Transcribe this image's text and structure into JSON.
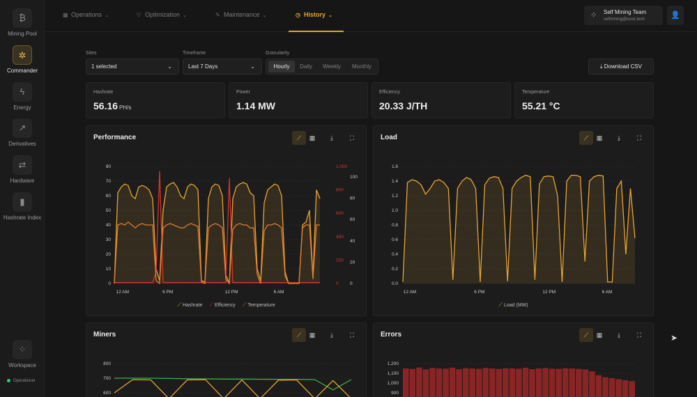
{
  "sidebar": {
    "items": [
      {
        "label": "Mining Pool",
        "icon": "bitcoin-icon",
        "glyph": "₿"
      },
      {
        "label": "Commander",
        "icon": "miner-fan-icon",
        "glyph": "✲"
      },
      {
        "label": "Energy",
        "icon": "lightning-icon",
        "glyph": "ϟ"
      },
      {
        "label": "Derivatives",
        "icon": "chart-icon",
        "glyph": "↗"
      },
      {
        "label": "Hardware",
        "icon": "swap-arrows-icon",
        "glyph": "⇄"
      },
      {
        "label": "Hashrate Index",
        "icon": "bar-chart-icon",
        "glyph": "▮"
      },
      {
        "label": "Workspace",
        "icon": "workspace-dots-icon",
        "glyph": "⁘"
      }
    ],
    "status": "Operational",
    "status_color": "#2ecc71"
  },
  "nav": {
    "tabs": [
      {
        "label": "Operations",
        "icon": "grid-icon",
        "glyph": "▦"
      },
      {
        "label": "Optimization",
        "icon": "filter-icon",
        "glyph": "▽"
      },
      {
        "label": "Maintenance",
        "icon": "wrench-icon",
        "glyph": "✎"
      },
      {
        "label": "History",
        "icon": "clock-icon",
        "glyph": "◷"
      }
    ],
    "team_name": "Self Mining Team",
    "team_email": "selfmining@luxor.tech"
  },
  "filters": {
    "sites_label": "Sites",
    "sites_value": "1 selected",
    "timeframe_label": "Timeframe",
    "timeframe_value": "Last 7 Days",
    "granularity_label": "Granularity",
    "granularity_options": [
      "Hourly",
      "Daily",
      "Weekly",
      "Monthly"
    ],
    "download_label": "Download CSV"
  },
  "stats": [
    {
      "label": "Hashrate",
      "value": "56.16",
      "unit": "PH/s"
    },
    {
      "label": "Power",
      "value": "1.14 MW",
      "unit": ""
    },
    {
      "label": "Efficiency",
      "value": "20.33 J/TH",
      "unit": ""
    },
    {
      "label": "Temperature",
      "value": "55.21 °C",
      "unit": ""
    }
  ],
  "colors": {
    "accent": "#e8a532",
    "efficiency": "#d9342b",
    "temperature": "#e07b2e",
    "miners_green": "#3fae4a",
    "errors_red": "#8a2525"
  },
  "panels": {
    "performance": {
      "title": "Performance"
    },
    "load": {
      "title": "Load"
    },
    "miners": {
      "title": "Miners"
    },
    "errors": {
      "title": "Errors"
    }
  },
  "chart_data": [
    {
      "type": "line",
      "title": "Performance",
      "x_ticks": [
        "12 AM",
        "6 PM",
        "12 PM",
        "6 AM"
      ],
      "y_left_ticks": [
        0,
        10,
        20,
        30,
        40,
        50,
        60,
        70,
        80
      ],
      "y_right_outer_ticks": [
        "0",
        "200",
        "400",
        "600",
        "800",
        "1,000"
      ],
      "y_right_inner_ticks": [
        0,
        20,
        40,
        60,
        80,
        100
      ],
      "series": [
        {
          "name": "Hashrate",
          "axis": "left",
          "values": [
            0,
            62,
            66,
            68,
            67,
            60,
            58,
            66,
            67,
            66,
            64,
            58,
            10,
            2,
            50,
            66,
            68,
            69,
            66,
            60,
            58,
            66,
            68,
            67,
            64,
            2,
            1,
            58,
            66,
            68,
            67,
            60,
            6,
            0,
            58,
            66,
            68,
            69,
            68,
            62,
            60,
            10,
            2,
            55,
            64,
            66,
            68,
            67,
            60,
            8,
            0,
            0,
            0,
            0,
            40,
            42,
            50,
            4,
            64,
            58
          ]
        },
        {
          "name": "Efficiency",
          "axis": "right-outer",
          "values": [
            8,
            8,
            8,
            8,
            8,
            8,
            8,
            8,
            8,
            8,
            8,
            8,
            100,
            960,
            8,
            8,
            8,
            8,
            8,
            8,
            8,
            8,
            8,
            8,
            8,
            8,
            8,
            8,
            8,
            8,
            8,
            8,
            8,
            900,
            8,
            8,
            8,
            8,
            8,
            8,
            8,
            8,
            8,
            8,
            8,
            8,
            8,
            8,
            8,
            8,
            8,
            8,
            8,
            8,
            8,
            8,
            8,
            8,
            8,
            8
          ]
        },
        {
          "name": "Temperature",
          "axis": "left",
          "values": [
            0,
            40,
            41,
            40,
            42,
            40,
            38,
            40,
            41,
            40,
            40,
            40,
            2,
            0,
            38,
            40,
            41,
            40,
            39,
            38,
            38,
            40,
            41,
            40,
            39,
            1,
            0,
            38,
            40,
            41,
            40,
            38,
            3,
            0,
            37,
            40,
            41,
            40,
            40,
            38,
            38,
            6,
            0,
            36,
            40,
            40,
            41,
            40,
            38,
            5,
            0,
            0,
            0,
            0,
            38,
            40,
            40,
            3,
            40,
            40
          ]
        }
      ]
    },
    {
      "type": "area",
      "title": "Load",
      "x_ticks": [
        "12 AM",
        "6 PM",
        "12 PM",
        "6 AM"
      ],
      "y_ticks": [
        0.0,
        0.2,
        0.4,
        0.6,
        0.8,
        1.0,
        1.2,
        1.4,
        1.6
      ],
      "series": [
        {
          "name": "Load (MW)",
          "values": [
            0.02,
            1.38,
            1.42,
            1.4,
            1.35,
            1.22,
            1.3,
            1.4,
            1.42,
            1.38,
            1.3,
            0.05,
            1.3,
            1.4,
            1.45,
            1.42,
            1.3,
            0.02,
            1.35,
            1.44,
            1.46,
            1.45,
            1.3,
            0.03,
            1.3,
            1.4,
            1.45,
            1.48,
            1.46,
            0.05,
            1.36,
            1.46,
            1.47,
            1.46,
            1.2,
            0.02,
            1.4,
            1.48,
            1.48,
            1.46,
            0.3,
            1.4,
            1.46,
            1.48,
            1.47,
            0.02,
            0.02,
            1.3,
            1.4,
            0.4,
            1.3,
            0.62
          ]
        }
      ]
    },
    {
      "type": "line",
      "title": "Miners",
      "y_ticks": [
        600,
        700,
        800
      ],
      "series": [
        {
          "name": "Green",
          "values": [
            700,
            700,
            700,
            698,
            696,
            695,
            694,
            694,
            693,
            692,
            692,
            690,
            620,
            690
          ]
        },
        {
          "name": "Yellow",
          "values": [
            600,
            690,
            688,
            560,
            688,
            690,
            560,
            688,
            560,
            686,
            688,
            560,
            684,
            560
          ]
        }
      ]
    },
    {
      "type": "bar",
      "title": "Errors",
      "y_ticks": [
        "900",
        "1,000",
        "1,100",
        "1,200"
      ],
      "series": [
        {
          "name": "Errors",
          "values": [
            1150,
            1145,
            1160,
            1140,
            1155,
            1150,
            1148,
            1158,
            1142,
            1153,
            1150,
            1146,
            1156,
            1149,
            1144,
            1152,
            1151,
            1147,
            1157,
            1143,
            1150,
            1154,
            1148,
            1146,
            1152,
            1150,
            1145,
            1140,
            1120,
            1080,
            1060,
            1050,
            1040,
            1030,
            1020
          ]
        }
      ]
    }
  ]
}
